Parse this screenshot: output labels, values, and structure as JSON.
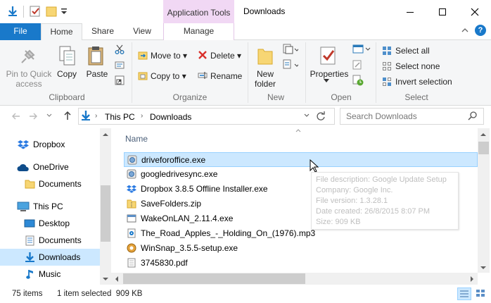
{
  "window": {
    "contextual_tab": "Application Tools",
    "title": "Downloads"
  },
  "tabs": {
    "file": "File",
    "home": "Home",
    "share": "Share",
    "view": "View",
    "manage": "Manage"
  },
  "ribbon": {
    "clipboard": {
      "pin": "Pin to Quick access",
      "pin_line1": "Pin to Quick",
      "pin_line2": "access",
      "copy": "Copy",
      "paste": "Paste",
      "group": "Clipboard"
    },
    "organize": {
      "move_to": "Move to",
      "copy_to": "Copy to",
      "delete": "Delete",
      "rename": "Rename",
      "group": "Organize"
    },
    "new": {
      "new_folder_line1": "New",
      "new_folder_line2": "folder",
      "group": "New"
    },
    "open": {
      "properties": "Properties",
      "group": "Open"
    },
    "select": {
      "select_all": "Select all",
      "select_none": "Select none",
      "invert": "Invert selection",
      "group": "Select"
    }
  },
  "address": {
    "crumb_1": "This PC",
    "crumb_2": "Downloads",
    "search_placeholder": "Search Downloads"
  },
  "nav_pane": {
    "items": [
      {
        "label": "Dropbox",
        "icon": "dropbox-icon"
      },
      {
        "label": "OneDrive",
        "icon": "onedrive-icon"
      },
      {
        "label": "Documents",
        "icon": "folder-icon"
      },
      {
        "label": "This PC",
        "icon": "computer-icon"
      },
      {
        "label": "Desktop",
        "icon": "desktop-icon"
      },
      {
        "label": "Documents",
        "icon": "documents-icon"
      },
      {
        "label": "Downloads",
        "icon": "downloads-icon",
        "selected": true
      },
      {
        "label": "Music",
        "icon": "music-icon"
      }
    ]
  },
  "file_list": {
    "column_name": "Name",
    "files": [
      {
        "name": "driveforoffice.exe",
        "icon": "installer-icon",
        "selected": true
      },
      {
        "name": "googledrivesync.exe",
        "icon": "installer-icon"
      },
      {
        "name": "Dropbox 3.8.5 Offline Installer.exe",
        "icon": "dropbox-icon"
      },
      {
        "name": "SaveFolders.zip",
        "icon": "zip-icon"
      },
      {
        "name": "WakeOnLAN_2.11.4.exe",
        "icon": "app-icon"
      },
      {
        "name": "The_Road_Apples_-_Holding_On_(1976).mp3",
        "icon": "audio-icon"
      },
      {
        "name": "WinSnap_3.5.5-setup.exe",
        "icon": "setup-icon"
      },
      {
        "name": "3745830.pdf",
        "icon": "pdf-icon"
      }
    ]
  },
  "tooltip": {
    "description": "File description: Google Update Setup",
    "company": "Company: Google Inc.",
    "version": "File version: 1.3.28.1",
    "date_created": "Date created: 26/8/2015 8:07 PM",
    "size": "Size: 909 KB"
  },
  "status_bar": {
    "item_count": "75 items",
    "selection": "1 item selected  909 KB"
  },
  "colors": {
    "file_tab": "#1979ca",
    "selection": "#cce8ff",
    "app_tools": "#f1d8f4"
  }
}
